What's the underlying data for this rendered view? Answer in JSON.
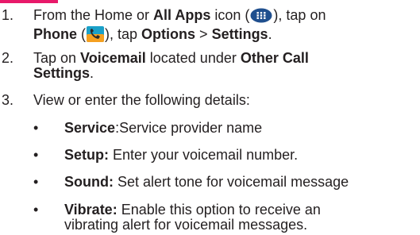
{
  "steps": [
    {
      "number": "1.",
      "line1_pre": "From the Home or ",
      "all_apps": "All Apps",
      "line1_mid": " icon (",
      "line1_post": "), tap on",
      "phone": "Phone",
      "line2_mid1": " (",
      "line2_mid2": "), tap ",
      "options": "Options",
      "gt": " > ",
      "settings": "Settings",
      "period": "."
    },
    {
      "number": "2.",
      "pre": "Tap on ",
      "voicemail": "Voicemail",
      "mid": " located under ",
      "other_call_1": "Other Call",
      "other_call_2": "Settings",
      "period": "."
    },
    {
      "number": "3.",
      "text": "View or enter the following details:"
    }
  ],
  "bullets": [
    {
      "symbol": "•",
      "term": "Service",
      "desc": ":Service provider name"
    },
    {
      "symbol": "•",
      "term": "Setup:",
      "desc": " Enter your voicemail number."
    },
    {
      "symbol": "•",
      "term": "Sound:",
      "desc": " Set alert tone for voicemail message"
    },
    {
      "symbol": "•",
      "term": "Vibrate:",
      "desc": " Enable this option to receive an",
      "desc2": "vibrating alert for voicemail messages."
    }
  ],
  "icons": [
    "all-apps-icon",
    "phone-icon"
  ],
  "colors": {
    "accent": "#e8196a",
    "text": "#231f20",
    "apps_icon_blue": "#1f4f8e"
  }
}
